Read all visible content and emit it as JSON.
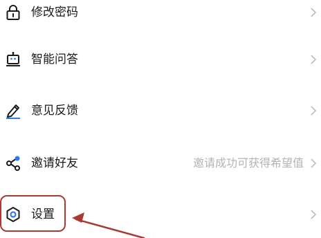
{
  "menu": {
    "items": [
      {
        "label": "修改密码",
        "hint": "",
        "icon": "lock-icon"
      },
      {
        "label": "智能问答",
        "hint": "",
        "icon": "robot-icon"
      },
      {
        "label": "意见反馈",
        "hint": "",
        "icon": "pen-icon"
      },
      {
        "label": "邀请好友",
        "hint": "邀请成功可获得希望值",
        "icon": "share-icon"
      },
      {
        "label": "设置",
        "hint": "",
        "icon": "settings-icon"
      }
    ],
    "chevron": "chevron-right-icon"
  },
  "annotation": {
    "color": "#a93a32",
    "highlight": "settings"
  },
  "colors": {
    "icon": "#1a1a1a",
    "accent_blue": "#2b7de9",
    "hint": "#b3b3b3",
    "chevron": "#bdbdbd"
  }
}
